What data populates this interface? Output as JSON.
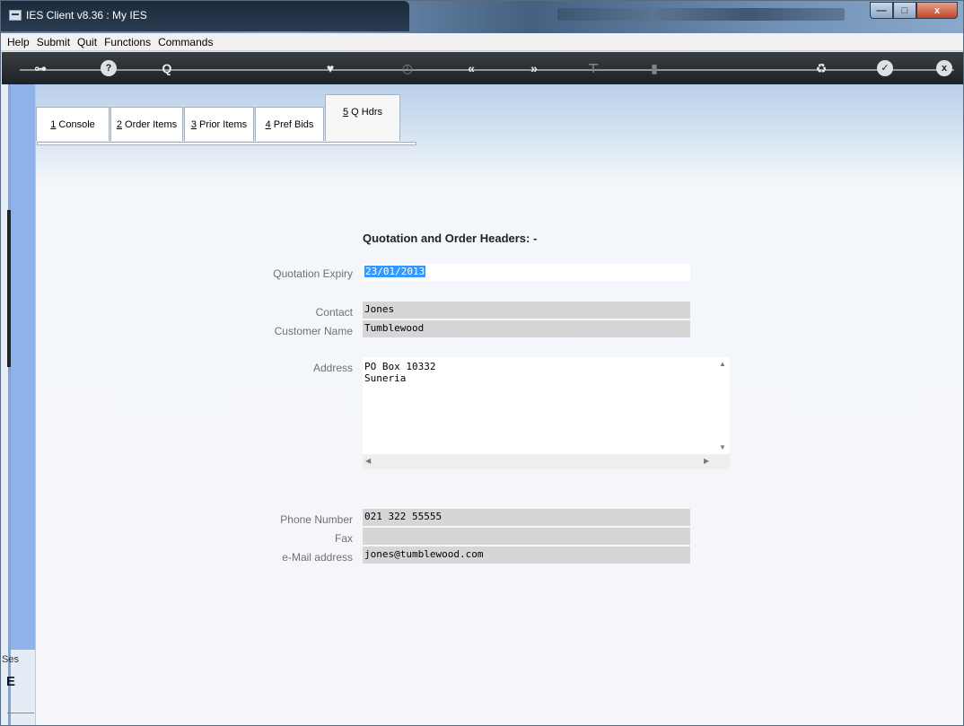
{
  "window": {
    "title": "IES Client v8.36 : My IES",
    "controls": {
      "minimize": "—",
      "maximize": "□",
      "close": "x"
    }
  },
  "menu": [
    "Help",
    "Submit",
    "Quit",
    "Functions",
    "Commands"
  ],
  "toolbar": {
    "icons": [
      "key-icon",
      "help-icon",
      "search-icon",
      "heart-icon",
      "clock-icon",
      "rewind-icon",
      "forward-icon",
      "tools-icon",
      "stop-icon",
      "recycle-icon",
      "check-icon",
      "close-icon"
    ],
    "glyphs": {
      "key": "⊶",
      "help": "?",
      "search": "Q",
      "heart": "♥",
      "clock": "◷",
      "rewind": "«",
      "forward": "»",
      "tools": "⊤",
      "stop": "▮",
      "recycle": "♻",
      "check": "✓",
      "close": "x"
    }
  },
  "tabs": [
    {
      "key": "1",
      "label": " Console"
    },
    {
      "key": "2",
      "label": " Order Items"
    },
    {
      "key": "3",
      "label": " Prior Items"
    },
    {
      "key": "4",
      "label": " Pref Bids"
    },
    {
      "key": "5",
      "label": " Q Hdrs"
    }
  ],
  "form": {
    "heading": "Quotation and Order Headers: -",
    "quotation_expiry": {
      "label": "Quotation Expiry",
      "value": "23/01/2013"
    },
    "contact": {
      "label": "Contact",
      "value": "Jones"
    },
    "customer_name": {
      "label": "Customer Name",
      "value": "Tumblewood"
    },
    "address": {
      "label": "Address",
      "value": "PO Box 10332\nSuneria"
    },
    "phone_number": {
      "label": "Phone Number",
      "value": "021 322 55555"
    },
    "fax": {
      "label": "Fax",
      "value": ""
    },
    "email": {
      "label": "e-Mail address",
      "value": "jones@tumblewood.com"
    }
  },
  "rail": {
    "session_label": "Ses",
    "marker": "E"
  },
  "scroll": {
    "up": "▲",
    "down": "▼",
    "left": "◀",
    "right": "▶"
  }
}
